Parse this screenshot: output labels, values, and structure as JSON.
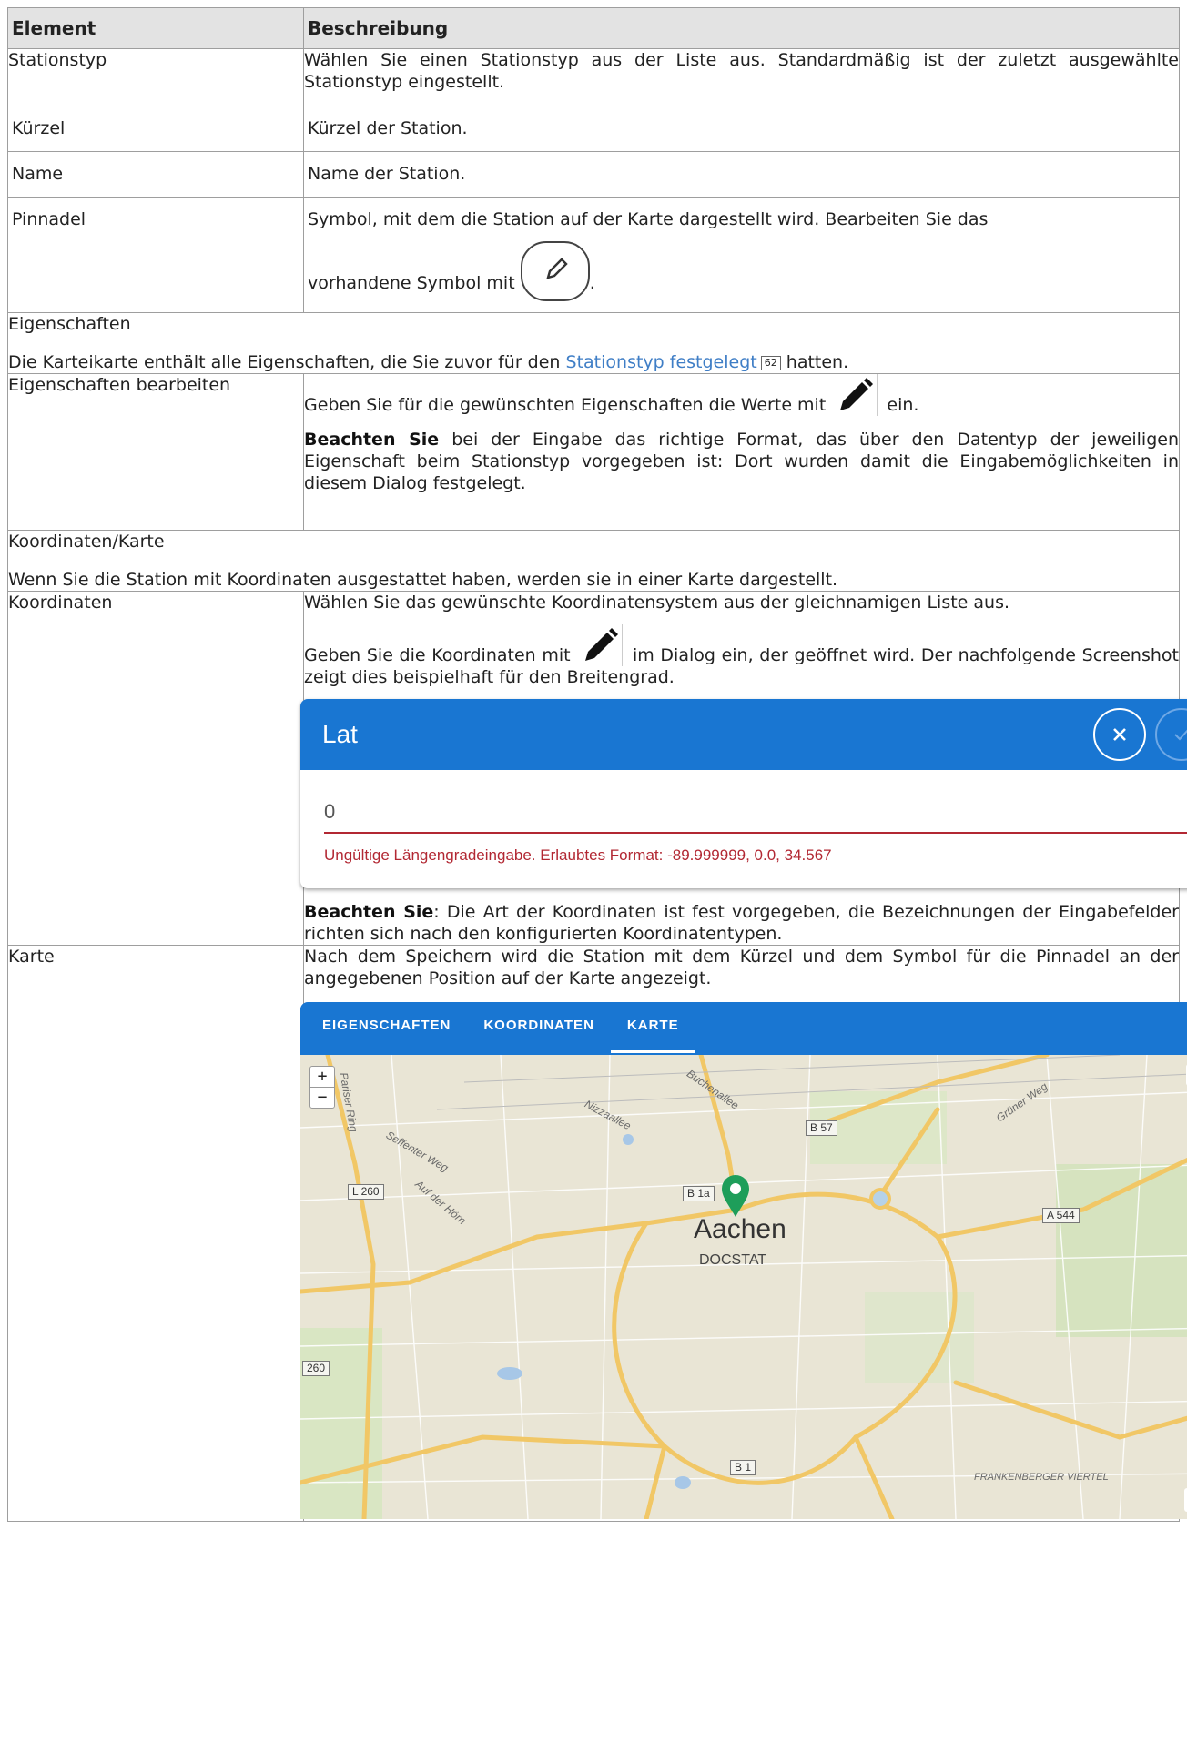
{
  "table": {
    "header": {
      "element": "Element",
      "description": "Beschreibung"
    },
    "rows": [
      {
        "element": "Stationstyp",
        "description": "Wählen Sie einen Stationstyp aus der Liste aus. Standardmäßig ist der zuletzt ausgewählte Stationstyp eingestellt."
      },
      {
        "element": "Kürzel",
        "description": "Kürzel der Station."
      },
      {
        "element": "Name",
        "description": "Name der Station."
      },
      {
        "element": "Pinnadel",
        "description": "Symbol, mit dem die Station auf der Karte dargestellt wird. Bearbeiten Sie das",
        "description_end": "vorhandene Symbol mit",
        "suffix": "."
      }
    ],
    "section_eigenschaften": {
      "title": "Eigenschaften",
      "text_before": "Die Karteikarte enthält alle Eigenschaften, die Sie zuvor für den",
      "link": "Stationstyp festgelegt",
      "page_ref": "62",
      "text_after": "hatten."
    },
    "row_eigenschaften_bearbeiten": {
      "element": "Eigenschaften bearbeiten",
      "p1_before": "Geben Sie für die gewünschten Eigenschaften die Werte mit",
      "p1_after": "ein.",
      "bold": "Beachten Sie",
      "p2": "bei der Eingabe das richtige Format, das über den Datentyp der jeweiligen Eigenschaft beim Stationstyp vorgegeben ist: Dort wurden damit die Eingabemöglichkeiten in diesem Dialog festgelegt."
    },
    "section_koordinaten": {
      "title": "Koordinaten/Karte",
      "text": "Wenn Sie die Station mit Koordinaten ausgestattet haben, werden sie in einer Karte dargestellt."
    },
    "row_koordinaten": {
      "element": "Koordinaten",
      "p1": "Wählen Sie das gewünschte Koordinatensystem aus der gleichnamigen Liste aus.",
      "p2_before": "Geben Sie die Koordinaten mit",
      "p2_after": "im Dialog ein, der geöffnet wird. Der nachfolgende Screenshot zeigt dies beispielhaft für den Breitengrad.",
      "bold": "Beachten Sie",
      "p3": ": Die Art der Koordinaten ist fest vorgegeben, die Bezeichnungen der Eingabefelder richten sich nach den konfigurierten Koordinatentypen."
    },
    "row_karte": {
      "element": "Karte",
      "p1": "Nach dem Speichern wird die Station mit dem Kürzel und dem Symbol für die Pinnadel an der angegebenen Position auf der Karte angezeigt."
    }
  },
  "dialog": {
    "title": "Lat",
    "value": "0",
    "error": "Ungültige Längengradeingabe. Erlaubtes Format: -89.999999, 0.0, 34.567"
  },
  "map_panel": {
    "tabs": [
      "EIGENSCHAFTEN",
      "KOORDINATEN",
      "KARTE"
    ],
    "active_tab": "KARTE",
    "zoom_in": "+",
    "zoom_out": "−",
    "info": "i",
    "city": "Aachen",
    "station": "DOCSTAT",
    "road_labels": [
      "B 57",
      "B 1a",
      "L 260",
      "A 544",
      "260",
      "B 1"
    ],
    "street_labels": [
      "Buchenallee",
      "Nizzaallee",
      "Grüner Weg",
      "Pariser Ring",
      "Seffenter Weg",
      "Auf der Hörn",
      "FRANKENBERGER VIERTEL"
    ],
    "colors": {
      "header": "#1976d2",
      "marker": "#1e9e5a",
      "error": "#b22833"
    }
  }
}
